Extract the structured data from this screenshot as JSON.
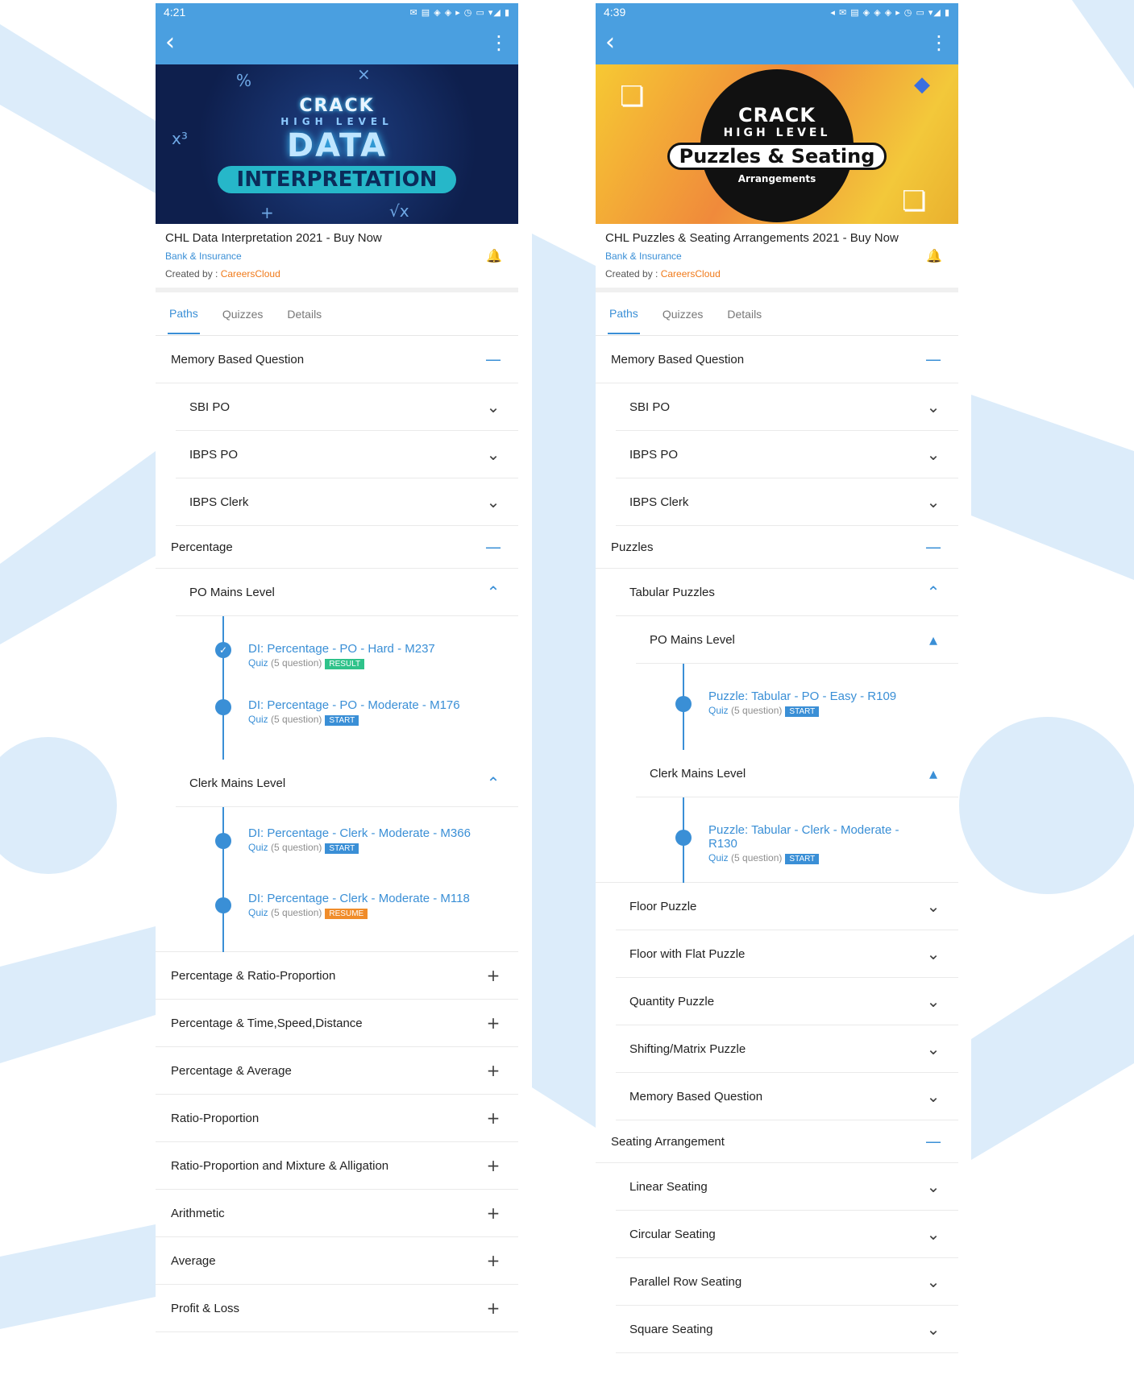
{
  "left": {
    "status": {
      "time": "4:21",
      "system": "✉ ▤ ◈ ◈ ▸   ◷ ▭ ▾◢ ▮"
    },
    "banner": {
      "l1": "CRACK",
      "l2": "HIGH LEVEL",
      "l3": "DATA",
      "l4": "INTERPRETATION"
    },
    "course": {
      "title": "CHL Data Interpretation 2021 - Buy Now",
      "category": "Bank & Insurance",
      "created_prefix": "Created by : ",
      "org": "CareersCloud"
    },
    "tabs": [
      "Paths",
      "Quizzes",
      "Details"
    ],
    "rows": {
      "memory": "Memory Based Question",
      "sbi": "SBI PO",
      "ibps_po": "IBPS PO",
      "ibps_clerk": "IBPS Clerk",
      "percentage": "Percentage",
      "po_mains": "PO Mains Level",
      "clerk_mains": "Clerk Mains Level",
      "r_pr": "Percentage & Ratio-Proportion",
      "r_tsd": "Percentage & Time,Speed,Distance",
      "r_avg": "Percentage & Average",
      "r_ratio": "Ratio-Proportion",
      "r_mix": "Ratio-Proportion and Mixture & Alligation",
      "r_arith": "Arithmetic",
      "r_average": "Average",
      "r_pl": "Profit & Loss"
    },
    "lessons": [
      {
        "title": "DI: Percentage - PO - Hard - M237",
        "quiz": "Quiz",
        "count": "(5 question)",
        "badge": "RESULT"
      },
      {
        "title": "DI: Percentage  - PO - Moderate - M176",
        "quiz": "Quiz",
        "count": "(5 question)",
        "badge": "START"
      },
      {
        "title": "DI: Percentage - Clerk - Moderate - M366",
        "quiz": "Quiz",
        "count": "(5 question)",
        "badge": "START"
      },
      {
        "title": "DI: Percentage - Clerk - Moderate - M118",
        "quiz": "Quiz",
        "count": "(5 question)",
        "badge": "RESUME"
      }
    ]
  },
  "right": {
    "status": {
      "time": "4:39",
      "system": "◂ ✉ ▤ ◈ ◈ ◈ ▸   ◷ ▭ ▾◢ ▮"
    },
    "banner": {
      "l1": "CRACK",
      "l2": "HIGH LEVEL",
      "l3": "Puzzles & Seating",
      "l4": "Arrangements"
    },
    "course": {
      "title": "CHL Puzzles & Seating Arrangements 2021 - Buy Now",
      "category": "Bank & Insurance",
      "created_prefix": "Created by : ",
      "org": "CareersCloud"
    },
    "tabs": [
      "Paths",
      "Quizzes",
      "Details"
    ],
    "rows": {
      "memory": "Memory Based Question",
      "sbi": "SBI PO",
      "ibps_po": "IBPS PO",
      "ibps_clerk": "IBPS Clerk",
      "puzzles": "Puzzles",
      "tabular": "Tabular Puzzles",
      "po_mains": "PO Mains Level",
      "clerk_mains": "Clerk Mains Level",
      "floor": "Floor Puzzle",
      "floor_flat": "Floor with Flat Puzzle",
      "quantity": "Quantity Puzzle",
      "shifting": "Shifting/Matrix Puzzle",
      "memory2": "Memory Based Question",
      "seating": "Seating Arrangement",
      "linear": "Linear Seating",
      "circular": "Circular Seating",
      "parallel": "Parallel Row Seating",
      "square": "Square Seating"
    },
    "lessons": [
      {
        "title": "Puzzle: Tabular - PO - Easy - R109",
        "quiz": "Quiz",
        "count": "(5 question)",
        "badge": "START"
      },
      {
        "title": "Puzzle: Tabular - Clerk - Moderate - R130",
        "quiz": "Quiz",
        "count": "(5 question)",
        "badge": "START"
      }
    ]
  },
  "icons": {
    "back": "back-arrow-icon",
    "more": "more-vert-icon",
    "collapse": "minus-icon",
    "expand": "plus-icon",
    "chevron_down": "chevron-down-icon",
    "chevron_up": "chevron-up-icon",
    "caret_up": "caret-up-icon",
    "bell": "bell-icon",
    "check": "check-icon"
  },
  "colors": {
    "primary": "#4a9fe0",
    "link": "#3a8fd6",
    "org": "#f07a1a",
    "result": "#2fc28a",
    "start": "#3a8fd6",
    "resume": "#f08c2a",
    "bg_shape": "#dcecfa"
  }
}
